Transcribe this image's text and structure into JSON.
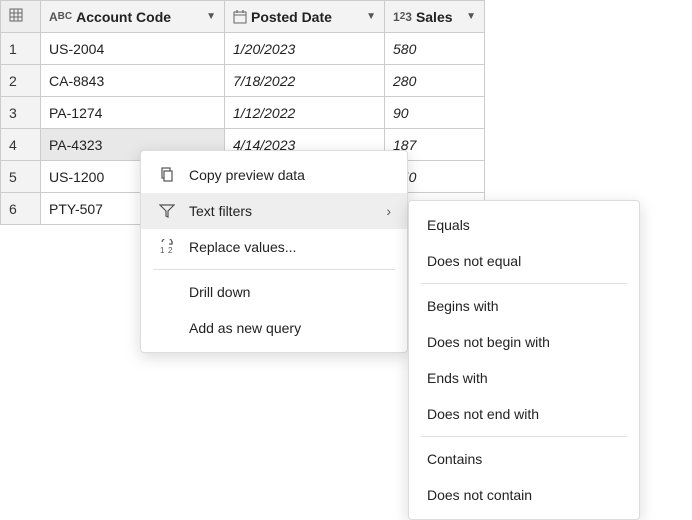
{
  "columns": {
    "acct": {
      "label": "Account Code",
      "type_icon": "abc"
    },
    "date": {
      "label": "Posted Date",
      "type_icon": "calendar"
    },
    "sales": {
      "label": "Sales",
      "type_icon": "123"
    }
  },
  "rows": [
    {
      "n": "1",
      "acct": "US-2004",
      "date": "1/20/2023",
      "sales": "580"
    },
    {
      "n": "2",
      "acct": "CA-8843",
      "date": "7/18/2022",
      "sales": "280"
    },
    {
      "n": "3",
      "acct": "PA-1274",
      "date": "1/12/2022",
      "sales": "90"
    },
    {
      "n": "4",
      "acct": "PA-4323",
      "date": "4/14/2023",
      "sales": "187"
    },
    {
      "n": "5",
      "acct": "US-1200",
      "date": "",
      "sales": "350"
    },
    {
      "n": "6",
      "acct": "PTY-507",
      "date": "",
      "sales": ""
    }
  ],
  "context_menu": {
    "copy": "Copy preview data",
    "text_filters": "Text filters",
    "replace": "Replace values...",
    "drill": "Drill down",
    "add_query": "Add as new query"
  },
  "text_filters_submenu": {
    "equals": "Equals",
    "not_equal": "Does not equal",
    "begins": "Begins with",
    "not_begin": "Does not begin with",
    "ends": "Ends with",
    "not_end": "Does not end with",
    "contains": "Contains",
    "not_contain": "Does not contain"
  }
}
